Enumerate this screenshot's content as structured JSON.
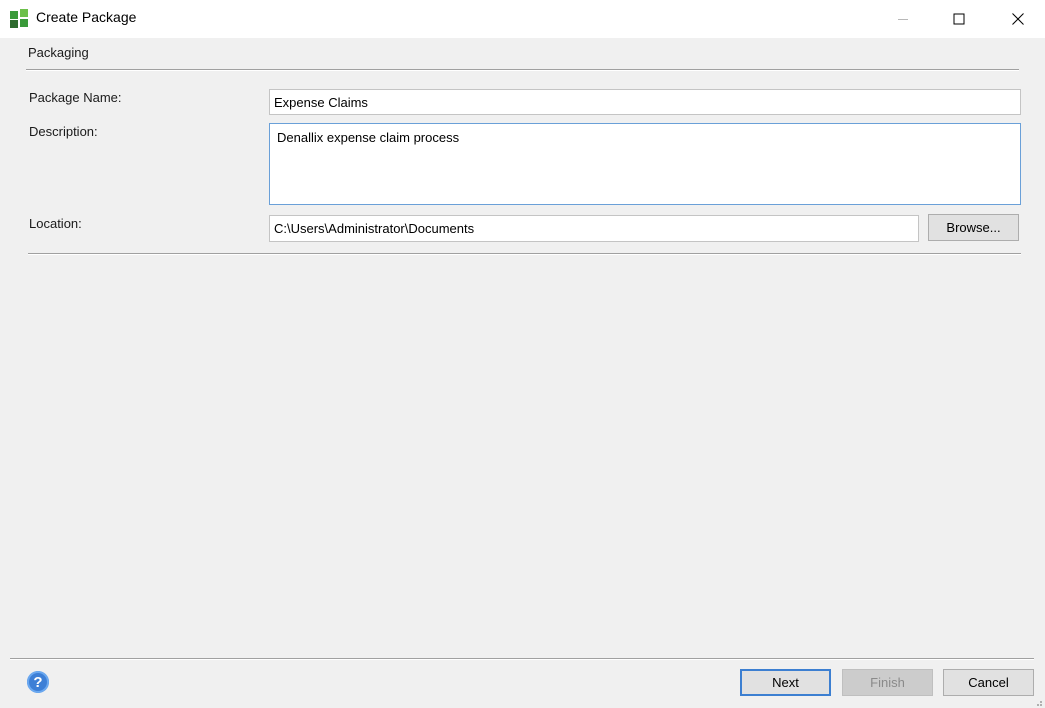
{
  "window": {
    "title": "Create Package",
    "icon": "package-grid-icon",
    "controls": [
      "minimize-icon",
      "maximize-icon",
      "close-icon"
    ]
  },
  "section": {
    "title": "Packaging"
  },
  "form": {
    "package_name": {
      "label": "Package Name:",
      "value": "Expense Claims"
    },
    "description": {
      "label": "Description:",
      "value": "Denallix expense claim process"
    },
    "location": {
      "label": "Location:",
      "value": "C:\\Users\\Administrator\\Documents",
      "browse_label": "Browse..."
    }
  },
  "footer": {
    "help_icon": "help-icon",
    "help_glyph": "?",
    "next_label": "Next",
    "finish_label": "Finish",
    "cancel_label": "Cancel"
  },
  "colors": {
    "accent": "#3c7fd1",
    "icon_green": "#3a9a3a",
    "icon_dark_green": "#2e6b2e"
  }
}
